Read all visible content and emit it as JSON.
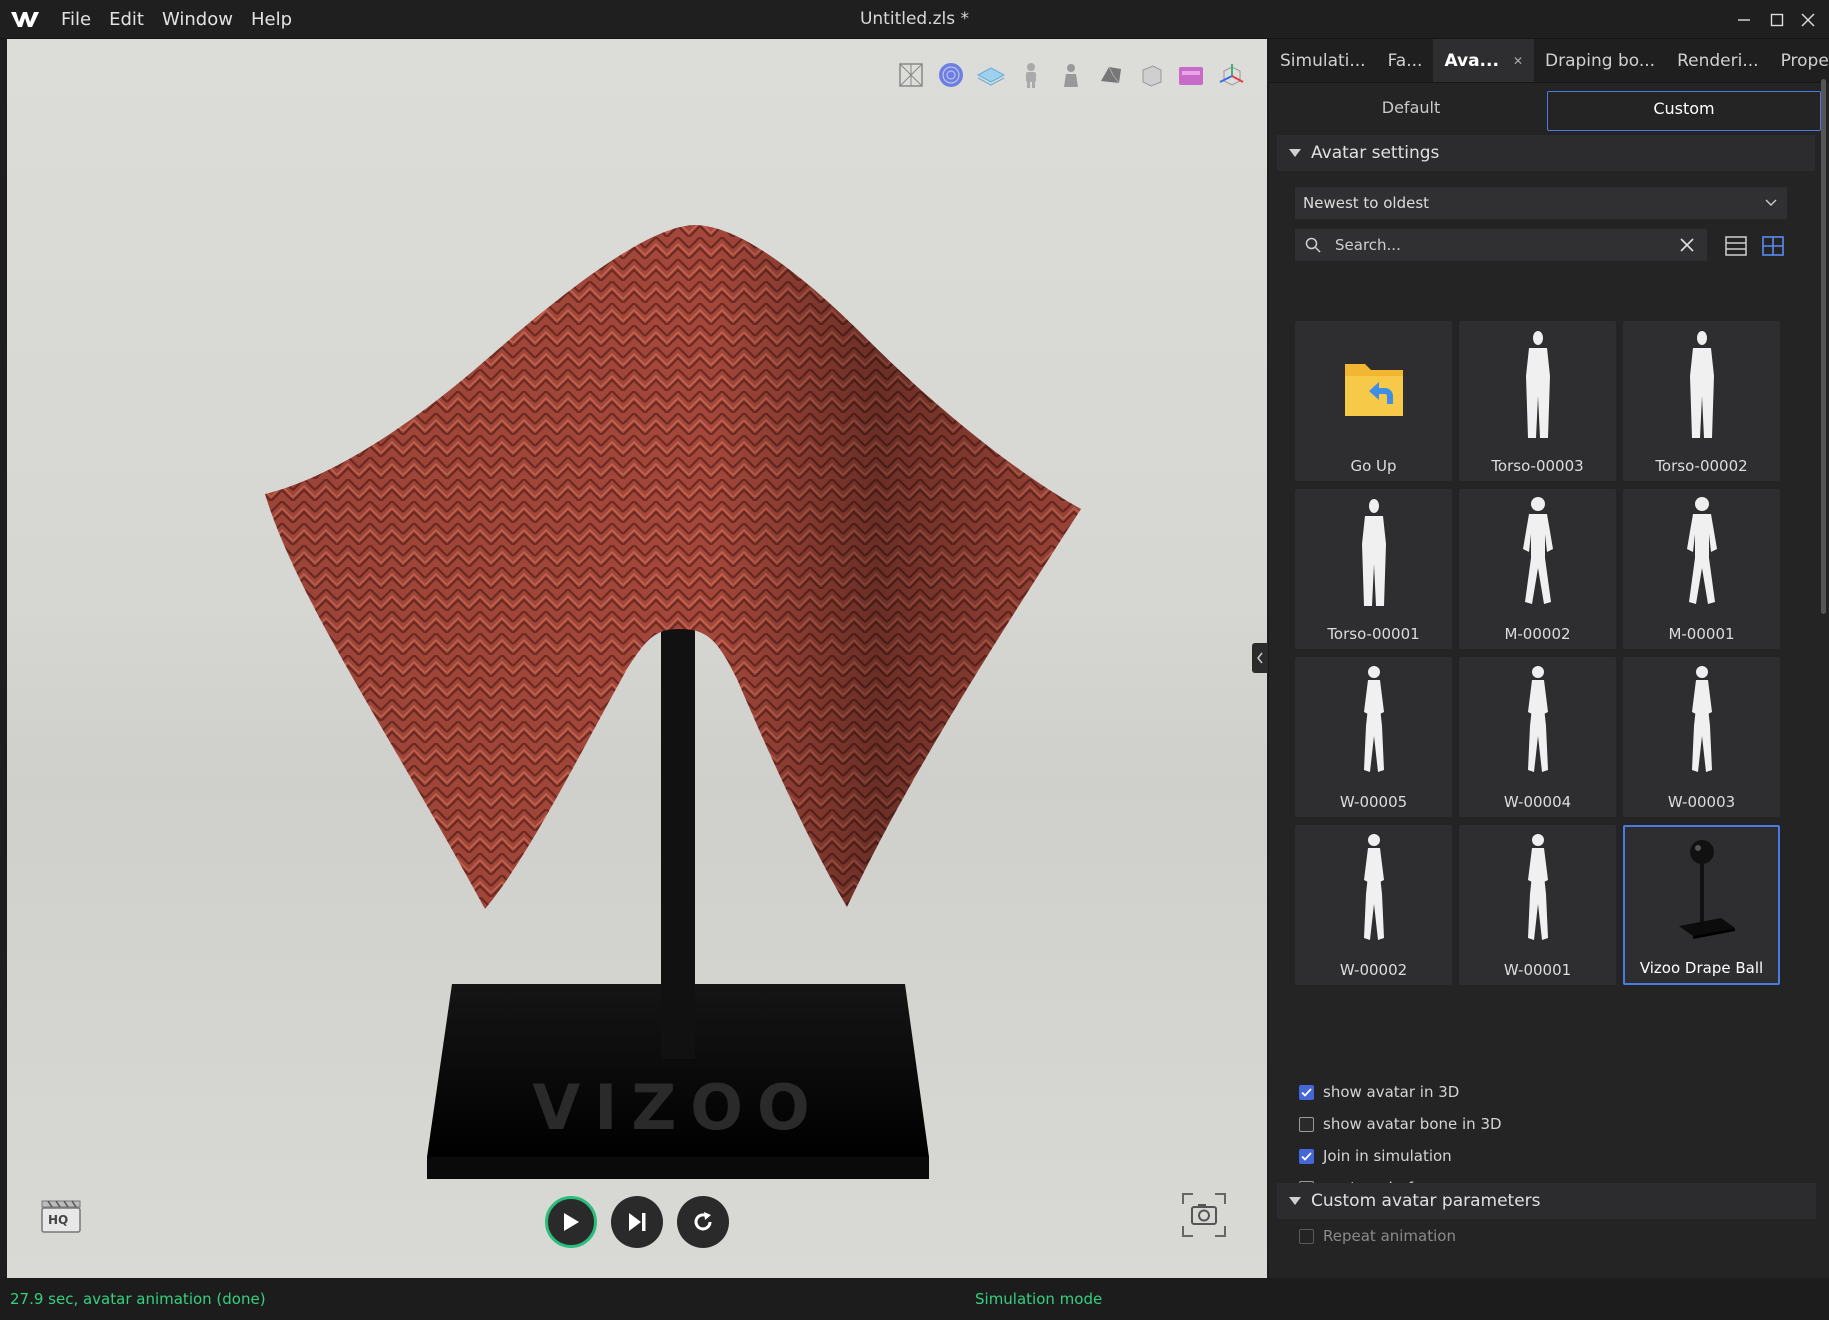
{
  "app": {
    "window_title": "Untitled.zls *",
    "menu": [
      "File",
      "Edit",
      "Window",
      "Help"
    ]
  },
  "viewport": {
    "hq_label": "HQ",
    "toolbar_icons": [
      "wireframe-icon",
      "particle-distance-icon",
      "fabric-layer-icon",
      "avatar-icon",
      "avatar-pose-icon",
      "texture-icon",
      "box-view-icon",
      "sewing-icon",
      "transform-gizmo-icon"
    ],
    "stand_brand": "VIZOO"
  },
  "panel": {
    "tabs": [
      "Simulati...",
      "Fa...",
      "Ava...",
      "Draping bo...",
      "Renderi...",
      "Propert..."
    ],
    "active_tab": "Ava...",
    "subtabs": [
      "Default",
      "Custom"
    ],
    "active_subtab": "Custom",
    "avatar_settings": {
      "title": "Avatar settings",
      "sort_value": "Newest to oldest",
      "search_placeholder": "Search...",
      "items": [
        {
          "label": "Go Up",
          "icon": "folder-up-icon"
        },
        {
          "label": "Torso-00003",
          "icon": "torso-avatar-icon"
        },
        {
          "label": "Torso-00002",
          "icon": "torso-avatar-icon"
        },
        {
          "label": "Torso-00001",
          "icon": "torso-avatar-icon"
        },
        {
          "label": "M-00002",
          "icon": "male-avatar-icon"
        },
        {
          "label": "M-00001",
          "icon": "male-avatar-icon"
        },
        {
          "label": "W-00005",
          "icon": "female-avatar-icon"
        },
        {
          "label": "W-00004",
          "icon": "female-avatar-icon"
        },
        {
          "label": "W-00003",
          "icon": "female-avatar-icon"
        },
        {
          "label": "W-00002",
          "icon": "female-avatar-icon"
        },
        {
          "label": "W-00001",
          "icon": "female-avatar-icon"
        },
        {
          "label": "Vizoo Drape Ball",
          "icon": "drape-ball-icon",
          "selected": true
        }
      ],
      "checkboxes": [
        {
          "label": "show avatar in 3D",
          "checked": true
        },
        {
          "label": "show avatar bone in 3D",
          "checked": false
        },
        {
          "label": "Join in simulation",
          "checked": true
        },
        {
          "label": "avatar wireframe",
          "checked": false
        }
      ]
    },
    "custom_params": {
      "title": "Custom avatar parameters",
      "repeat_animation": "Repeat animation"
    }
  },
  "status": {
    "left": "27.9 sec, avatar animation (done)",
    "mode": "Simulation mode"
  },
  "colors": {
    "accent": "#4a7be0",
    "status_green": "#35d07f",
    "fabric": "#a9493a"
  }
}
